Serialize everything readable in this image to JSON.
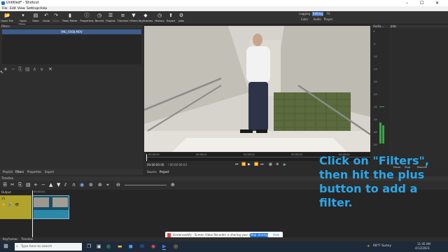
{
  "window": {
    "title": "Untitled* - Shotcut",
    "controls": [
      "–",
      "☐",
      "✕"
    ]
  },
  "menu": [
    "File",
    "Edit",
    "View",
    "Settings",
    "Help"
  ],
  "toolbar": [
    {
      "label": "Open File",
      "icon": "folder-open-icon",
      "glyph": "📂"
    },
    {
      "label": "Open Other...",
      "icon": "folder-icon",
      "glyph": "▾"
    },
    {
      "label": "Save",
      "icon": "save-icon",
      "glyph": "▤"
    },
    {
      "label": "Undo",
      "icon": "undo-icon",
      "glyph": "↶"
    },
    {
      "label": "Redo",
      "icon": "redo-icon",
      "glyph": "↷"
    },
    {
      "label": "Peak Meter",
      "icon": "meter-icon",
      "glyph": "▮"
    },
    {
      "label": "Properties",
      "icon": "properties-icon",
      "glyph": "ⓘ"
    },
    {
      "label": "Recent",
      "icon": "clock-icon",
      "glyph": "◷"
    },
    {
      "label": "Playlist",
      "icon": "playlist-icon",
      "glyph": "☰"
    },
    {
      "label": "Timeline",
      "icon": "timeline-icon",
      "glyph": "≡"
    },
    {
      "label": "Filters",
      "icon": "filter-icon",
      "glyph": "▼"
    },
    {
      "label": "Keyframes",
      "icon": "keyframes-icon",
      "glyph": "◆"
    },
    {
      "label": "History",
      "icon": "history-icon",
      "glyph": "◷"
    },
    {
      "label": "Export",
      "icon": "export-icon",
      "glyph": "⬆"
    },
    {
      "label": "Jobs",
      "icon": "jobs-icon",
      "glyph": "⚙"
    }
  ],
  "workspaces": {
    "top": [
      "Logging",
      "Editing",
      "FX"
    ],
    "bottom": [
      "Color",
      "Audio",
      "Player"
    ],
    "selected": "Editing"
  },
  "filters_panel": {
    "title": "Filters",
    "clip_name": "IMG_0568.MOV"
  },
  "left_tabs": [
    "Playlist",
    "Filters",
    "Properties",
    "Export"
  ],
  "viewer_tabs": [
    "Source",
    "Project"
  ],
  "ruler_ticks": [
    "00:00:00",
    "00:00:01",
    "00:00:02",
    "00:00:03",
    "00:00:04"
  ],
  "timecode": {
    "current": "00:00:00:00",
    "total": "/ 00:00:00:03"
  },
  "audio_panel": {
    "title": "Audio...",
    "scale": [
      "0",
      "-5",
      "-10",
      "-15",
      "-20",
      "-25",
      "-30",
      "-35",
      "-40",
      "-50"
    ]
  },
  "jobs_panel": {
    "title": "Jobs",
    "buttons": [
      "Pause",
      "Stop",
      "Resume"
    ]
  },
  "timeline": {
    "title": "Timeline",
    "track_header": "Output",
    "track_name": "V1",
    "clip_time": "00:00:00"
  },
  "bottom_tabs": [
    "Keyframes",
    "Timeline"
  ],
  "taskbar": {
    "search_placeholder": "Type here to search",
    "weather": "68°F  Sunny",
    "time": "11:45 AM",
    "date": "4/12/2023"
  },
  "share_banner": {
    "text": "Screencastify - Screen Video Recorder is sharing your screen.",
    "stop": "Stop sharing",
    "hide": "Hide"
  },
  "overlay_text": "Click on \"Filters\", then hit the plus button to add a filter."
}
